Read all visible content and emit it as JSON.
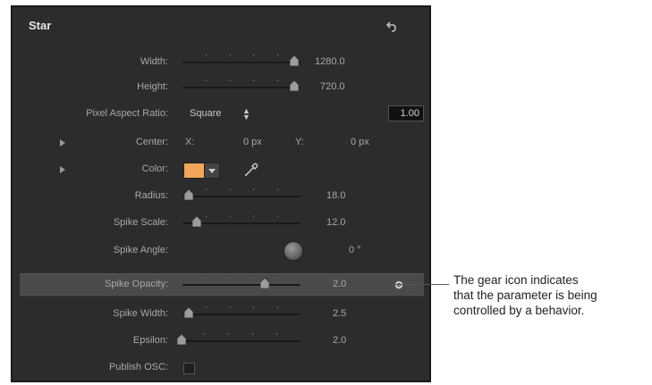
{
  "panel": {
    "title": "Star",
    "reset_icon": "reset-arrow-icon"
  },
  "params": {
    "width": {
      "label": "Width:",
      "value": "1280.0",
      "slider_fraction": 0.95
    },
    "height": {
      "label": "Height:",
      "value": "720.0",
      "slider_fraction": 0.95
    },
    "pixel_aspect": {
      "label": "Pixel Aspect Ratio:",
      "selected": "Square",
      "number": "1.00"
    },
    "center": {
      "label": "Center:",
      "x_label": "X:",
      "x_value": "0 px",
      "y_label": "Y:",
      "y_value": "0 px"
    },
    "color": {
      "label": "Color:",
      "swatch_color": "#f2a65a"
    },
    "radius": {
      "label": "Radius:",
      "value": "18.0",
      "slider_fraction": 0.05
    },
    "spike_scale": {
      "label": "Spike Scale:",
      "value": "12.0",
      "slider_fraction": 0.12
    },
    "spike_angle": {
      "label": "Spike Angle:",
      "value": "0 °"
    },
    "spike_opacity": {
      "label": "Spike Opacity:",
      "value": "2.0",
      "slider_fraction": 0.7,
      "behavior_icon": "gear-icon"
    },
    "spike_width": {
      "label": "Spike Width:",
      "value": "2.5",
      "slider_fraction": 0.05
    },
    "epsilon": {
      "label": "Epsilon:",
      "value": "2.0",
      "slider_fraction": 0.02
    },
    "publish_osc": {
      "label": "Publish OSC:",
      "checked": false
    }
  },
  "callout": {
    "line1": "The gear icon indicates",
    "line2": "that the parameter is being",
    "line3": "controlled by a behavior."
  }
}
